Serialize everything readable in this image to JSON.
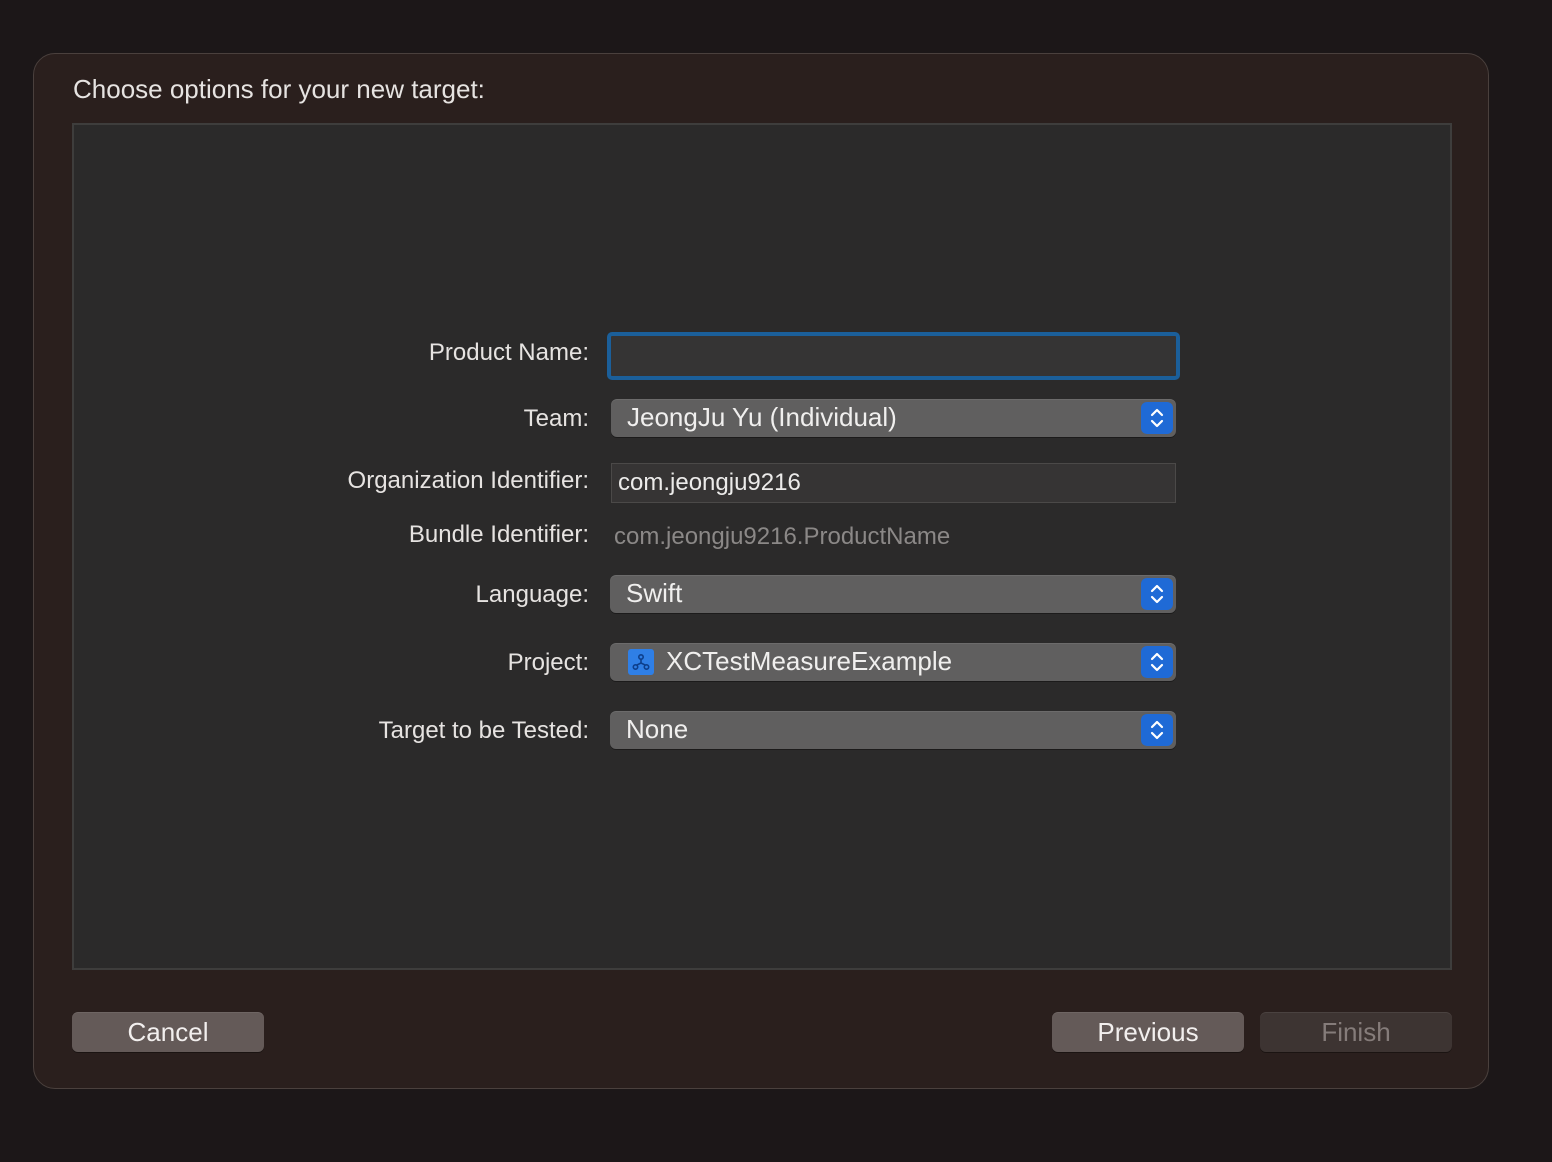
{
  "dialog": {
    "title": "Choose options for your new target:"
  },
  "form": {
    "product_name": {
      "label": "Product Name:",
      "value": ""
    },
    "team": {
      "label": "Team:",
      "value": "JeongJu Yu (Individual)"
    },
    "organization_identifier": {
      "label": "Organization Identifier:",
      "value": "com.jeongju9216"
    },
    "bundle_identifier": {
      "label": "Bundle Identifier:",
      "value": "com.jeongju9216.ProductName"
    },
    "language": {
      "label": "Language:",
      "value": "Swift"
    },
    "project": {
      "label": "Project:",
      "value": "XCTestMeasureExample",
      "icon": "xcode-project-icon"
    },
    "target_to_be_tested": {
      "label": "Target to be Tested:",
      "value": "None"
    }
  },
  "buttons": {
    "cancel": "Cancel",
    "previous": "Previous",
    "finish": "Finish"
  },
  "colors": {
    "accent": "#1f6ad6",
    "focus_ring": "#1b5f9a",
    "sheet_background": "#2a1f1d",
    "panel_background": "#2b2a2a"
  }
}
